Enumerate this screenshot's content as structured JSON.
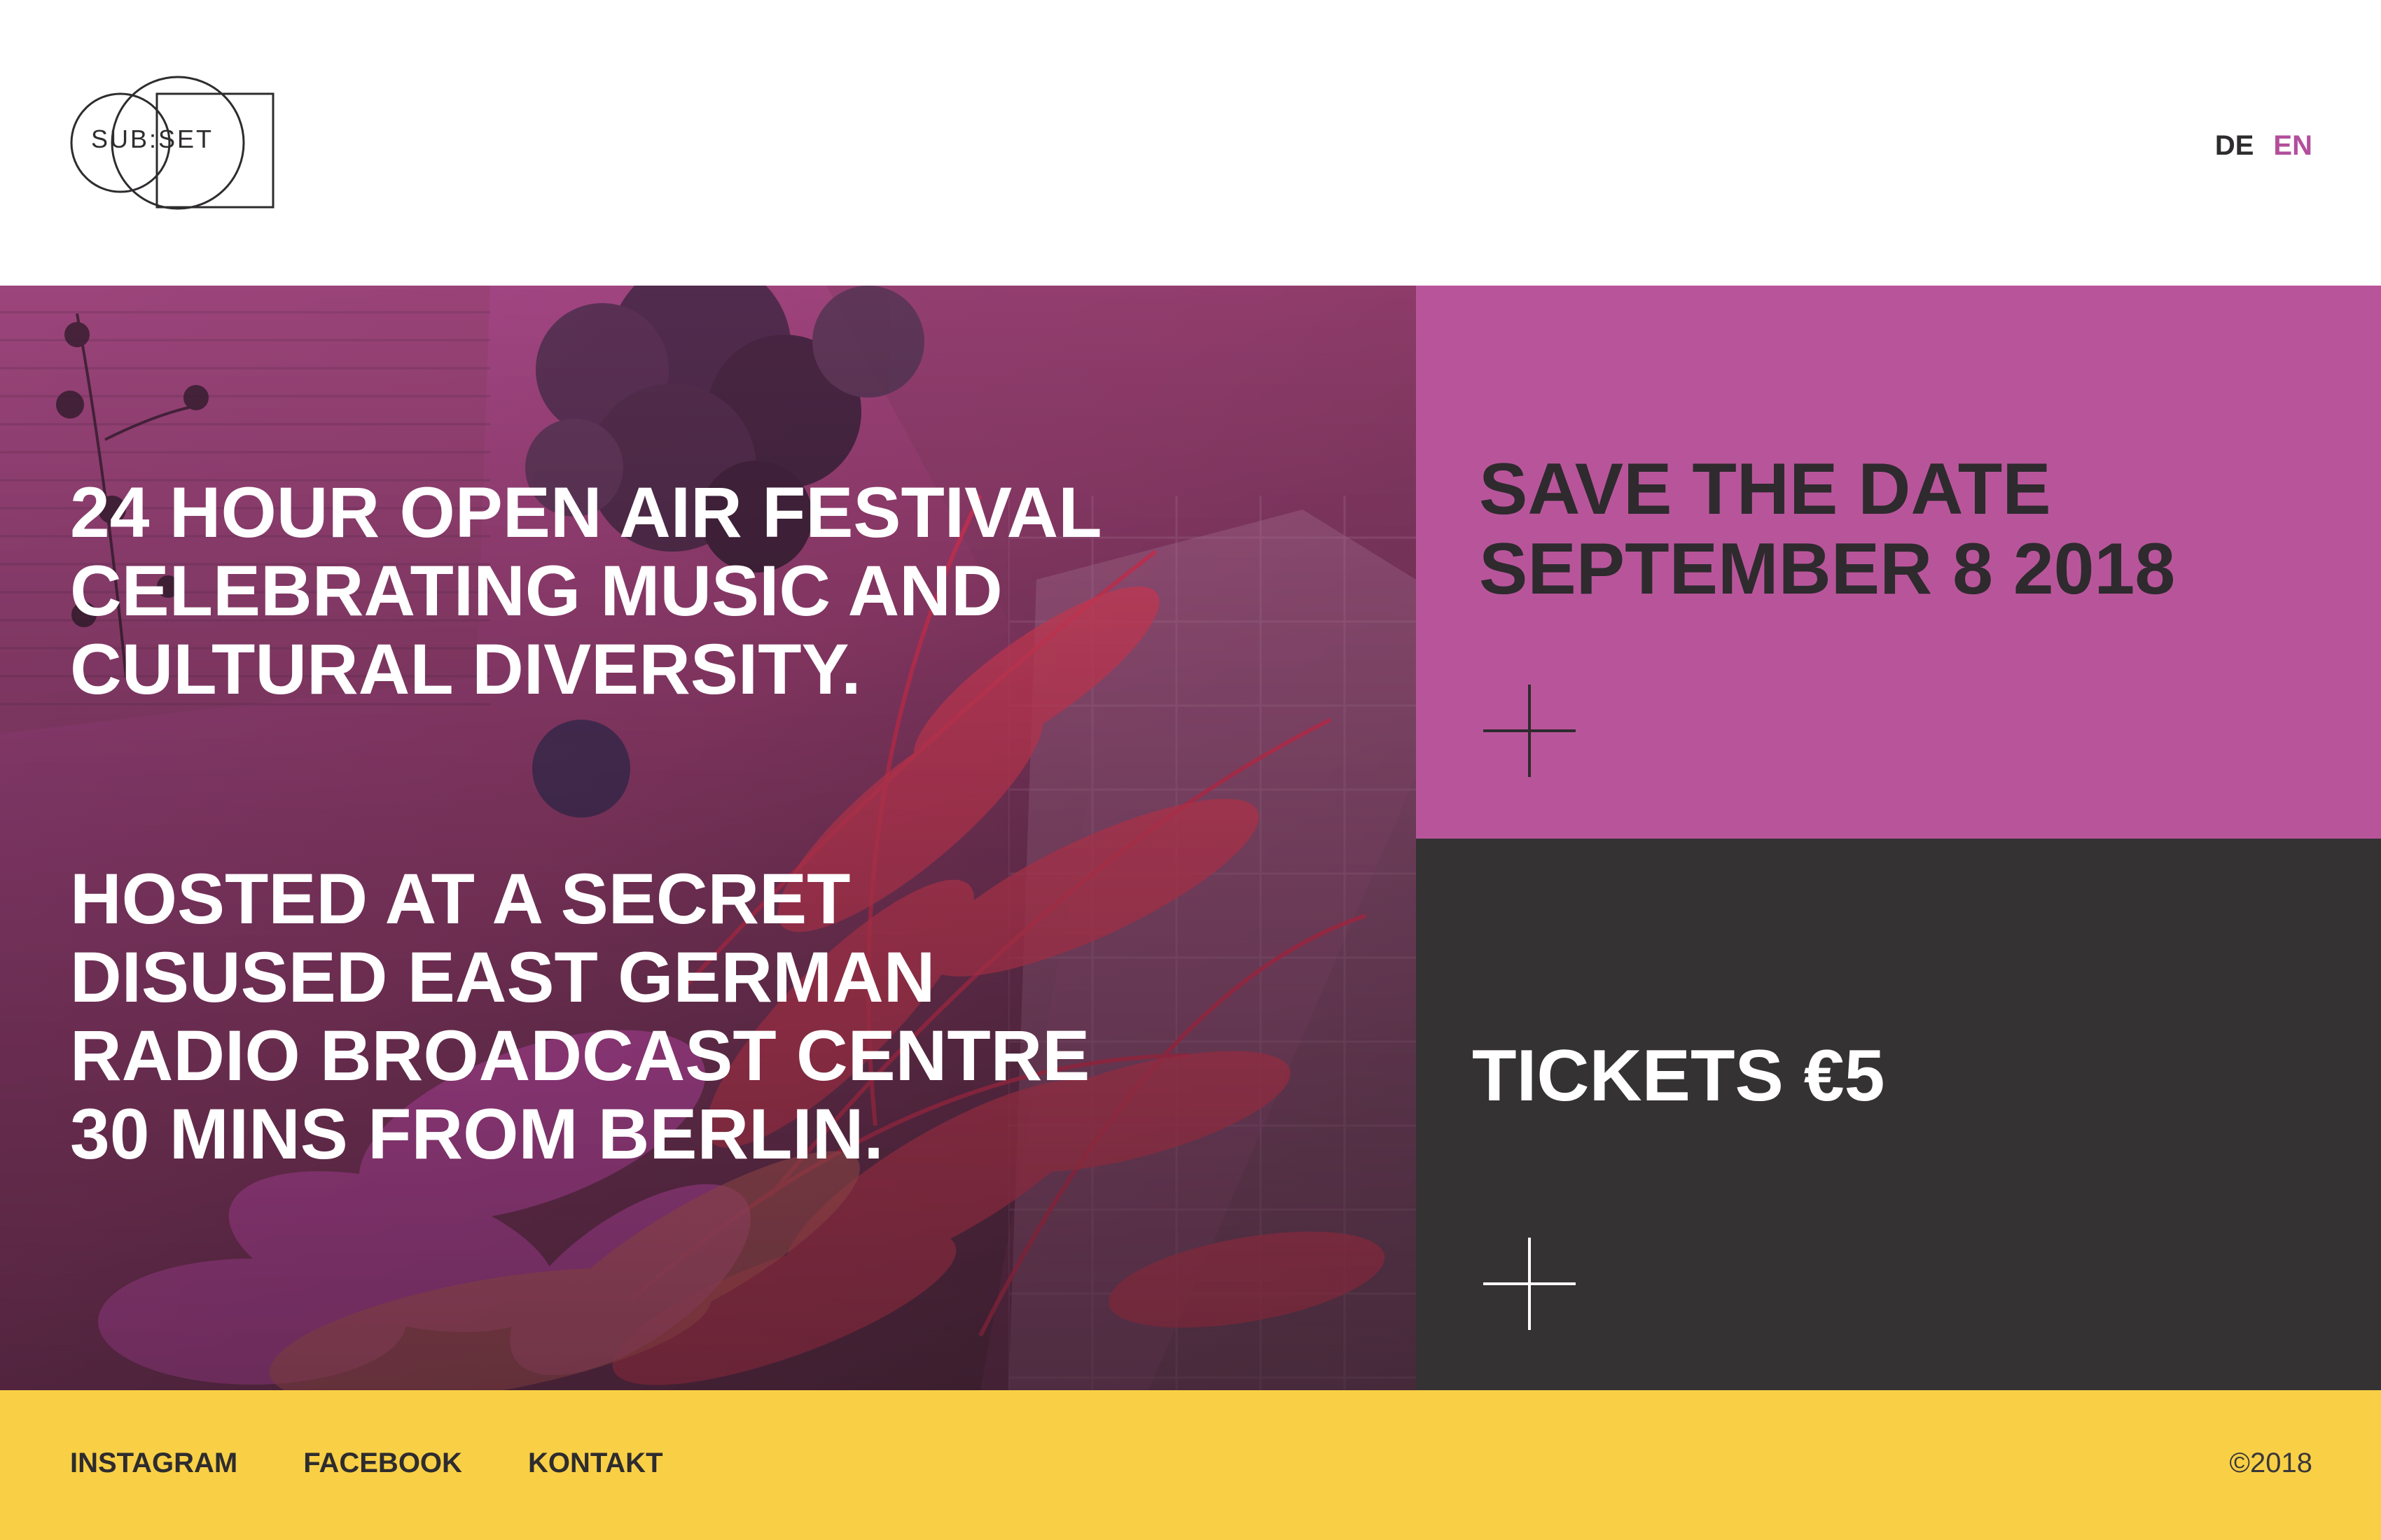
{
  "header": {
    "logo_text": "SUB:SET",
    "languages": [
      {
        "label": "DE",
        "active": false
      },
      {
        "label": "EN",
        "active": true
      }
    ]
  },
  "hero": {
    "paragraphs": [
      "24 HOUR OPEN AIR FESTIVAL CELEBRATING MUSIC AND CULTURAL DIVERSITY.",
      "HOSTED AT A SECRET DISUSED EAST GERMAN RADIO BROADCAST CENTRE 30 MINS FROM BERLIN."
    ]
  },
  "save_the_date": {
    "line1": "SAVE THE DATE",
    "line2": "SEPTEMBER 8 2018",
    "icon": "plus-icon"
  },
  "tickets": {
    "label": "TICKETS €5",
    "icon": "plus-icon"
  },
  "footer": {
    "links": [
      "INSTAGRAM",
      "FACEBOOK",
      "KONTAKT"
    ],
    "copyright": "©2018"
  },
  "colors": {
    "magenta": "#b8559a",
    "dark": "#353234",
    "yellow": "#f9d045",
    "accent_link": "#b24f9c"
  }
}
